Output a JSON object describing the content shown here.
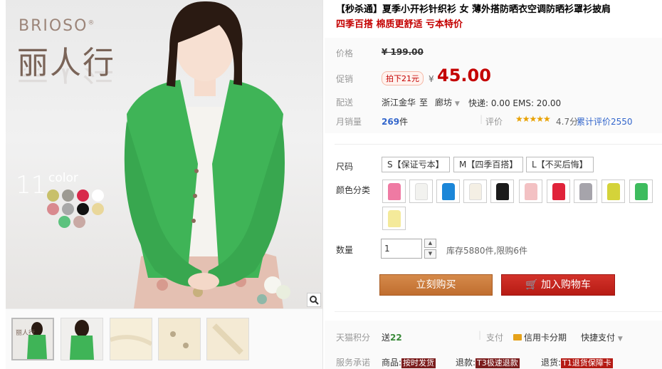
{
  "gallery": {
    "brand_en": "BRIOSO",
    "brand_mark": "®",
    "brand_cn": "丽人行",
    "color_count_num": "11",
    "color_count_word": "color",
    "swatch_colors": [
      "#c8c06a",
      "#9d9a92",
      "#d8294a",
      "#ffffff",
      "#d98a8f",
      "#a8a8a8",
      "#111111",
      "#e9d79a",
      "#5cc27e",
      "#c9a9a4"
    ]
  },
  "product": {
    "title": "【秒杀通】夏季小开衫针织衫 女 薄外搭防晒衣空调防晒衫罩衫披肩",
    "subtitle": "四季百搭 棉质更舒适 亏本特价"
  },
  "pricing": {
    "price_label": "价格",
    "original_price": "¥ 199.00",
    "promo_label": "促销",
    "promo_tag": "拍下21元",
    "currency": "¥",
    "sale_price": "45.00"
  },
  "shipping": {
    "label": "配送",
    "from": "浙江金华",
    "to_word": "至",
    "destination": "廊坊",
    "fees": "快递: 0.00 EMS: 20.00"
  },
  "sales": {
    "label": "月销量",
    "count": "269",
    "unit": "件",
    "review_label": "评价",
    "stars": "★★★★★",
    "rating": "4.7分",
    "cumulative": "累计评价2550"
  },
  "size": {
    "label": "尺码",
    "options": [
      "S【保证亏本】",
      "M【四季百搭】",
      "L【不买后悔】"
    ]
  },
  "colors": {
    "label": "颜色分类",
    "options": [
      "#ef7aa3",
      "#f2f2ef",
      "#1b86d8",
      "#f4efe4",
      "#1b1b1b",
      "#f3c1c3",
      "#e0233a",
      "#a6a4ab",
      "#d4d33a",
      "#3ebc5e",
      "#f4ea9a"
    ]
  },
  "quantity": {
    "label": "数量",
    "value": "1",
    "up": "▲",
    "down": "▼",
    "stock": "库存5880件,限购6件"
  },
  "actions": {
    "buy_now": "立刻购买",
    "add_to_cart": "加入购物车"
  },
  "footer": {
    "points_label": "天猫积分",
    "points_prefix": "送",
    "points_value": "22",
    "pay_label": "支付",
    "credit": "信用卡分期",
    "quick_pay": "快捷支付",
    "service_label": "服务承诺",
    "goods_label": "商品:",
    "goods_badge": "按时发货",
    "refund_label": "退款:",
    "refund_badge": "T3极速退款",
    "return_label": "退货:",
    "return_badge": "T1退货保障卡"
  }
}
